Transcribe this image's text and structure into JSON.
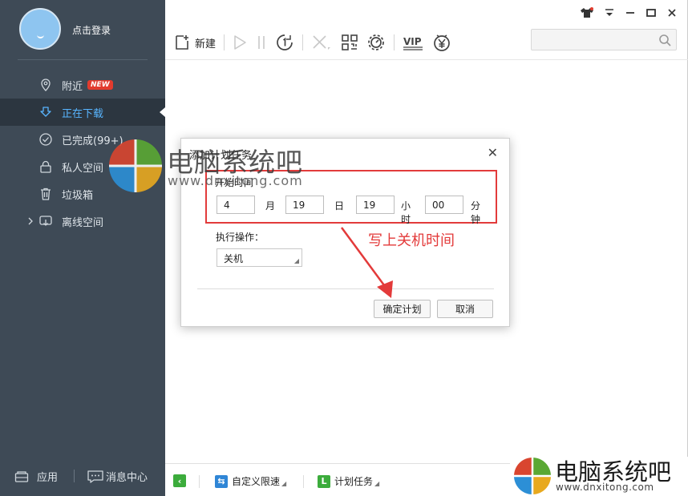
{
  "sidebar": {
    "login_label": "点击登录",
    "items": [
      {
        "label": "附近",
        "badge": "NEW",
        "icon": "location-pin-icon"
      },
      {
        "label": "正在下载",
        "icon": "download-arrow-icon",
        "active": true
      },
      {
        "label": "已完成(99+)",
        "icon": "check-circle-icon"
      },
      {
        "label": "私人空间",
        "icon": "lock-icon"
      },
      {
        "label": "垃圾箱",
        "icon": "trash-icon"
      },
      {
        "label": "离线空间",
        "icon": "cloud-download-icon"
      }
    ],
    "bottom": {
      "apps_label": "应用",
      "messages_label": "消息中心"
    }
  },
  "toolbar": {
    "new_label": "新建",
    "search_placeholder": ""
  },
  "statusbar": {
    "speed_label": "自定义限速",
    "schedule_label": "计划任务"
  },
  "dialog": {
    "title": "添加计划任务",
    "start_time_label": "开始时间",
    "month_value": "4",
    "month_unit": "月",
    "day_value": "19",
    "day_unit": "日",
    "hour_value": "19",
    "hour_unit": "小时",
    "minute_value": "00",
    "minute_unit": "分钟",
    "action_label": "执行操作：",
    "action_value": "关机",
    "confirm_label": "确定计划",
    "cancel_label": "取消"
  },
  "annotation": "写上关机时间",
  "watermark": {
    "name": "电脑系统吧",
    "url_center": "www.dnxitong.com",
    "url_corner": "www.dnxitong.com"
  },
  "colors": {
    "sidebar_bg": "#3e4a56",
    "active_text": "#58b5ff",
    "highlight": "#e23b3b",
    "annotation": "#e33a3a",
    "badge": "#e23b2e"
  }
}
